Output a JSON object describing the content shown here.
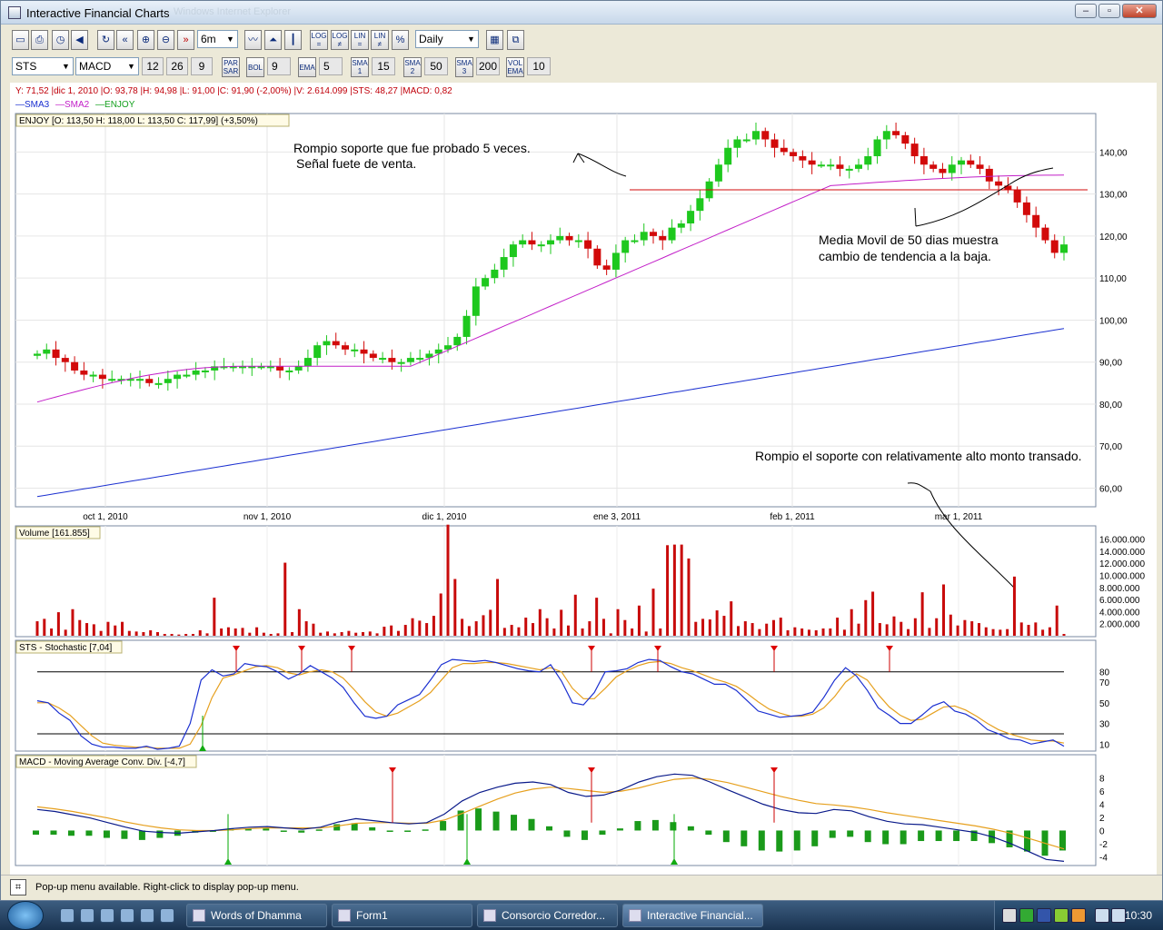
{
  "window": {
    "title": "Interactive Financial Charts",
    "ghost_title": "Windows Internet Explorer"
  },
  "toolbar1": {
    "period": "6m",
    "interval": "Daily",
    "buttons": [
      "LOG =",
      "LOG ≠",
      "LIN =",
      "LIN ≠",
      "%"
    ]
  },
  "toolbar2": {
    "symbol": "STS",
    "indicator": "MACD",
    "macd_params": [
      "12",
      "26",
      "9"
    ],
    "parsar_label": "PAR SAR",
    "bol_label": "BOL",
    "bol_value": "9",
    "ema_label": "EMA",
    "ema_value": "5",
    "sma1_label": "SMA 1",
    "sma1_value": "15",
    "sma2_label": "SMA 2",
    "sma2_value": "50",
    "sma3_label": "SMA 3",
    "sma3_value": "200",
    "volema_label": "VOL EMA",
    "volema_value": "10"
  },
  "info_line": "Y: 71,52 |dic 1, 2010 |O: 93,78 |H: 94,98 |L: 91,00 |C: 91,90 (-2,00%) |V: 2.614.099 |STS: 48,27 |MACD: 0,82",
  "legend": [
    {
      "label": "SMA3",
      "color": "#1a2fd0"
    },
    {
      "label": "SMA2",
      "color": "#c21ec8"
    },
    {
      "label": "ENJOY",
      "color": "#14a01e"
    }
  ],
  "colors": {
    "up": "#1ec81e",
    "down": "#d20a0a",
    "sma2": "#c21ec8",
    "sma3": "#1a2fd0",
    "stoch_slow": "#e6a01e",
    "volume": "#c80a0a"
  },
  "price_panel": {
    "header": "ENJOY [O: 113,50  H: 118,00  L: 113,50  C: 117,99] (+3,50%)",
    "y_ticks": [
      "140,00",
      "130,00",
      "120,00",
      "110,00",
      "100,00",
      "90,00",
      "80,00",
      "70,00",
      "60,00"
    ],
    "x_ticks": [
      "oct 1, 2010",
      "nov 1, 2010",
      "dic 1, 2010",
      "ene 3, 2011",
      "feb 1, 2011",
      "mar 1, 2011"
    ],
    "annotation1_line1": "Rompio soporte que fue probado 5 veces.",
    "annotation1_line2": "Señal fuete de venta.",
    "annotation2_line1": "Media Movil de 50 dias muestra",
    "annotation2_line2": "cambio de tendencia a la baja.",
    "annotation3": "Rompio el soporte con relativamente alto monto transado.",
    "support_level": 131
  },
  "volume_panel": {
    "header": "Volume [161.855]",
    "y_ticks": [
      "16.000.000",
      "14.000.000",
      "12.000.000",
      "10.000.000",
      "8.000.000",
      "6.000.000",
      "4.000.000",
      "2.000.000"
    ]
  },
  "stoch_panel": {
    "header": "STS - Stochastic [7,04]",
    "y_ticks": [
      "80",
      "70",
      "50",
      "30",
      "10"
    ]
  },
  "macd_panel": {
    "header": "MACD - Moving Average Conv. Div. [-4,7]",
    "y_ticks": [
      "8",
      "6",
      "4",
      "2",
      "0",
      "-2",
      "-4"
    ]
  },
  "chart_data": [
    {
      "type": "candlestick",
      "title": "ENJOY",
      "x_range": [
        "2010-09-22",
        "2011-03-17"
      ],
      "ylim": [
        56,
        147
      ],
      "support": 131,
      "closes": [
        92,
        93,
        91,
        90,
        88,
        87,
        87,
        86,
        86,
        86,
        86,
        86,
        85,
        85,
        86,
        87,
        87,
        88,
        88,
        89,
        89,
        89,
        89,
        89,
        89,
        89,
        88,
        88,
        89,
        91,
        94,
        95,
        94,
        93,
        93,
        92,
        91,
        91,
        90,
        90,
        91,
        91,
        92,
        93,
        94,
        96,
        101,
        108,
        110,
        112,
        115,
        118,
        119,
        118,
        118,
        119,
        120,
        119,
        119,
        117,
        113,
        112,
        116,
        119,
        119,
        121,
        120,
        119,
        122,
        123,
        126,
        129,
        133,
        137,
        141,
        143,
        143,
        145,
        143,
        141,
        140,
        139,
        138,
        137,
        137,
        137,
        136,
        136,
        137,
        139,
        143,
        145,
        144,
        142,
        139,
        137,
        136,
        135,
        137,
        138,
        137,
        136,
        133,
        132,
        131,
        128,
        125,
        122,
        119,
        116,
        118
      ]
    },
    {
      "type": "bar",
      "title": "Volume",
      "ylim": [
        0,
        17000000
      ],
      "values": [
        2.4,
        2.8,
        1.2,
        3.9,
        1.0,
        4.4,
        2.6,
        2.1,
        1.9,
        0.8,
        2.3,
        1.7,
        2.3,
        0.8,
        0.7,
        0.6,
        0.9,
        0.6,
        0.3,
        0.3,
        0.2,
        0.3,
        0.3,
        0.9,
        0.4,
        6.3,
        1.2,
        1.4,
        1.2,
        1.3,
        0.5,
        1.4,
        0.5,
        0.3,
        0.4,
        12.1,
        0.6,
        4.4,
        2.4,
        2.0,
        0.5,
        0.7,
        0.4,
        0.6,
        0.8,
        0.5,
        0.6,
        0.7,
        0.4,
        1.5,
        1.7,
        0.8,
        1.8,
        2.9,
        2.5,
        2.1,
        3.3,
        7.0,
        18.4,
        9.4,
        2.8,
        1.6,
        2.4,
        3.4,
        4.3,
        9.4,
        1.3,
        1.8,
        1.4,
        3.0,
        2.1,
        4.4,
        2.9,
        1.2,
        4.3,
        1.7,
        6.8,
        1.2,
        2.4,
        6.3,
        2.8,
        0.4,
        4.4,
        2.6,
        1.2,
        5.0,
        0.7,
        7.8,
        1.2,
        15.0,
        15.1,
        15.1,
        12.8,
        2.3,
        2.8,
        2.7,
        4.2,
        3.3,
        5.7,
        1.6,
        2.4,
        2.1,
        1.1,
        2.0,
        2.6,
        3.0,
        0.9,
        1.4,
        1.2,
        1.0,
        0.9,
        1.2,
        1.2,
        3.0,
        1.0,
        4.4,
        2.0,
        5.9,
        7.3,
        2.1,
        1.9,
        3.2,
        2.3,
        1.1,
        2.9,
        7.2,
        1.3,
        2.9,
        8.5,
        3.5,
        1.7,
        2.6,
        2.4,
        2.1,
        1.4,
        1.1,
        1.0,
        1.1,
        9.8,
        2.2,
        1.8,
        2.2,
        1.0,
        1.4,
        5.0,
        0.3
      ]
    },
    {
      "type": "line",
      "title": "STS - Stochastic [7,04]",
      "ylim": [
        0,
        100
      ],
      "ref_lines": [
        20,
        80
      ],
      "series": [
        {
          "values": [
            52,
            50,
            40,
            33,
            18,
            10,
            7,
            7,
            6,
            6,
            8,
            5,
            6,
            8,
            30,
            72,
            82,
            76,
            78,
            88,
            86,
            85,
            80,
            73,
            78,
            86,
            80,
            74,
            65,
            50,
            37,
            35,
            37,
            48,
            53,
            58,
            72,
            87,
            92,
            91,
            90,
            91,
            89,
            86,
            83,
            81,
            80,
            87,
            71,
            50,
            48,
            60,
            80,
            81,
            83,
            89,
            92,
            91,
            85,
            80,
            78,
            73,
            68,
            68,
            62,
            52,
            42,
            39,
            36,
            37,
            38,
            41,
            55,
            72,
            84,
            76,
            62,
            45,
            38,
            30,
            30,
            38,
            47,
            51,
            42,
            39,
            33,
            24,
            20,
            15,
            14,
            10,
            12,
            14,
            8
          ]
        },
        {
          "values": [
            50,
            50,
            45,
            38,
            28,
            18,
            11,
            9,
            8,
            7,
            7,
            6,
            6,
            6,
            10,
            28,
            55,
            74,
            77,
            81,
            85,
            86,
            84,
            79,
            77,
            80,
            82,
            80,
            74,
            63,
            51,
            41,
            37,
            40,
            46,
            52,
            60,
            72,
            84,
            88,
            88,
            89,
            89,
            88,
            86,
            84,
            82,
            84,
            80,
            64,
            54,
            54,
            64,
            75,
            81,
            86,
            89,
            90,
            88,
            84,
            81,
            77,
            73,
            70,
            66,
            59,
            51,
            44,
            40,
            37,
            37,
            39,
            45,
            56,
            70,
            78,
            72,
            58,
            46,
            38,
            33,
            34,
            40,
            46,
            47,
            43,
            37,
            30,
            24,
            20,
            17,
            14,
            13,
            13,
            11
          ]
        }
      ]
    },
    {
      "type": "line",
      "title": "MACD - Moving Average Conv. Div. [-4,7]",
      "ylim": [
        -5,
        9.5
      ],
      "series": [
        {
          "values": [
            3.2,
            2.9,
            2.4,
            1.9,
            1.2,
            0.5,
            -0.1,
            -0.3,
            -0.4,
            -0.2,
            0.0,
            0.3,
            0.5,
            0.6,
            0.4,
            0.2,
            0.5,
            1.3,
            1.8,
            1.5,
            1.2,
            1.0,
            1.2,
            2.5,
            4.5,
            5.8,
            6.6,
            7.2,
            7.4,
            7.0,
            5.8,
            5.2,
            5.4,
            6.2,
            7.4,
            8.2,
            8.6,
            8.4,
            7.4,
            6.2,
            5.1,
            4.0,
            3.2,
            2.7,
            2.6,
            3.2,
            3.0,
            2.1,
            1.4,
            1.0,
            0.9,
            0.5,
            0.1,
            -0.3,
            -1.0,
            -2.0,
            -3.2,
            -4.4,
            -4.7
          ]
        },
        {
          "values": [
            3.6,
            3.3,
            2.9,
            2.4,
            1.9,
            1.3,
            0.8,
            0.4,
            0.1,
            0.0,
            0.0,
            0.1,
            0.3,
            0.4,
            0.4,
            0.4,
            0.4,
            0.7,
            1.1,
            1.2,
            1.2,
            1.1,
            1.1,
            1.6,
            2.6,
            3.7,
            4.8,
            5.7,
            6.3,
            6.6,
            6.4,
            6.1,
            5.8,
            6.0,
            6.5,
            7.2,
            7.8,
            8.0,
            7.8,
            7.3,
            6.6,
            5.9,
            5.2,
            4.6,
            4.1,
            3.9,
            3.6,
            3.2,
            2.7,
            2.3,
            1.9,
            1.5,
            1.1,
            0.7,
            0.2,
            -0.4,
            -1.2,
            -2.0,
            -2.8
          ]
        }
      ]
    }
  ],
  "status": {
    "text": "Pop-up menu available. Right-click to display pop-up menu."
  },
  "taskbar": {
    "items": [
      "Words of Dhamma",
      "Form1",
      "Consorcio Corredor...",
      "Interactive Financial..."
    ],
    "clock": "10:30"
  }
}
